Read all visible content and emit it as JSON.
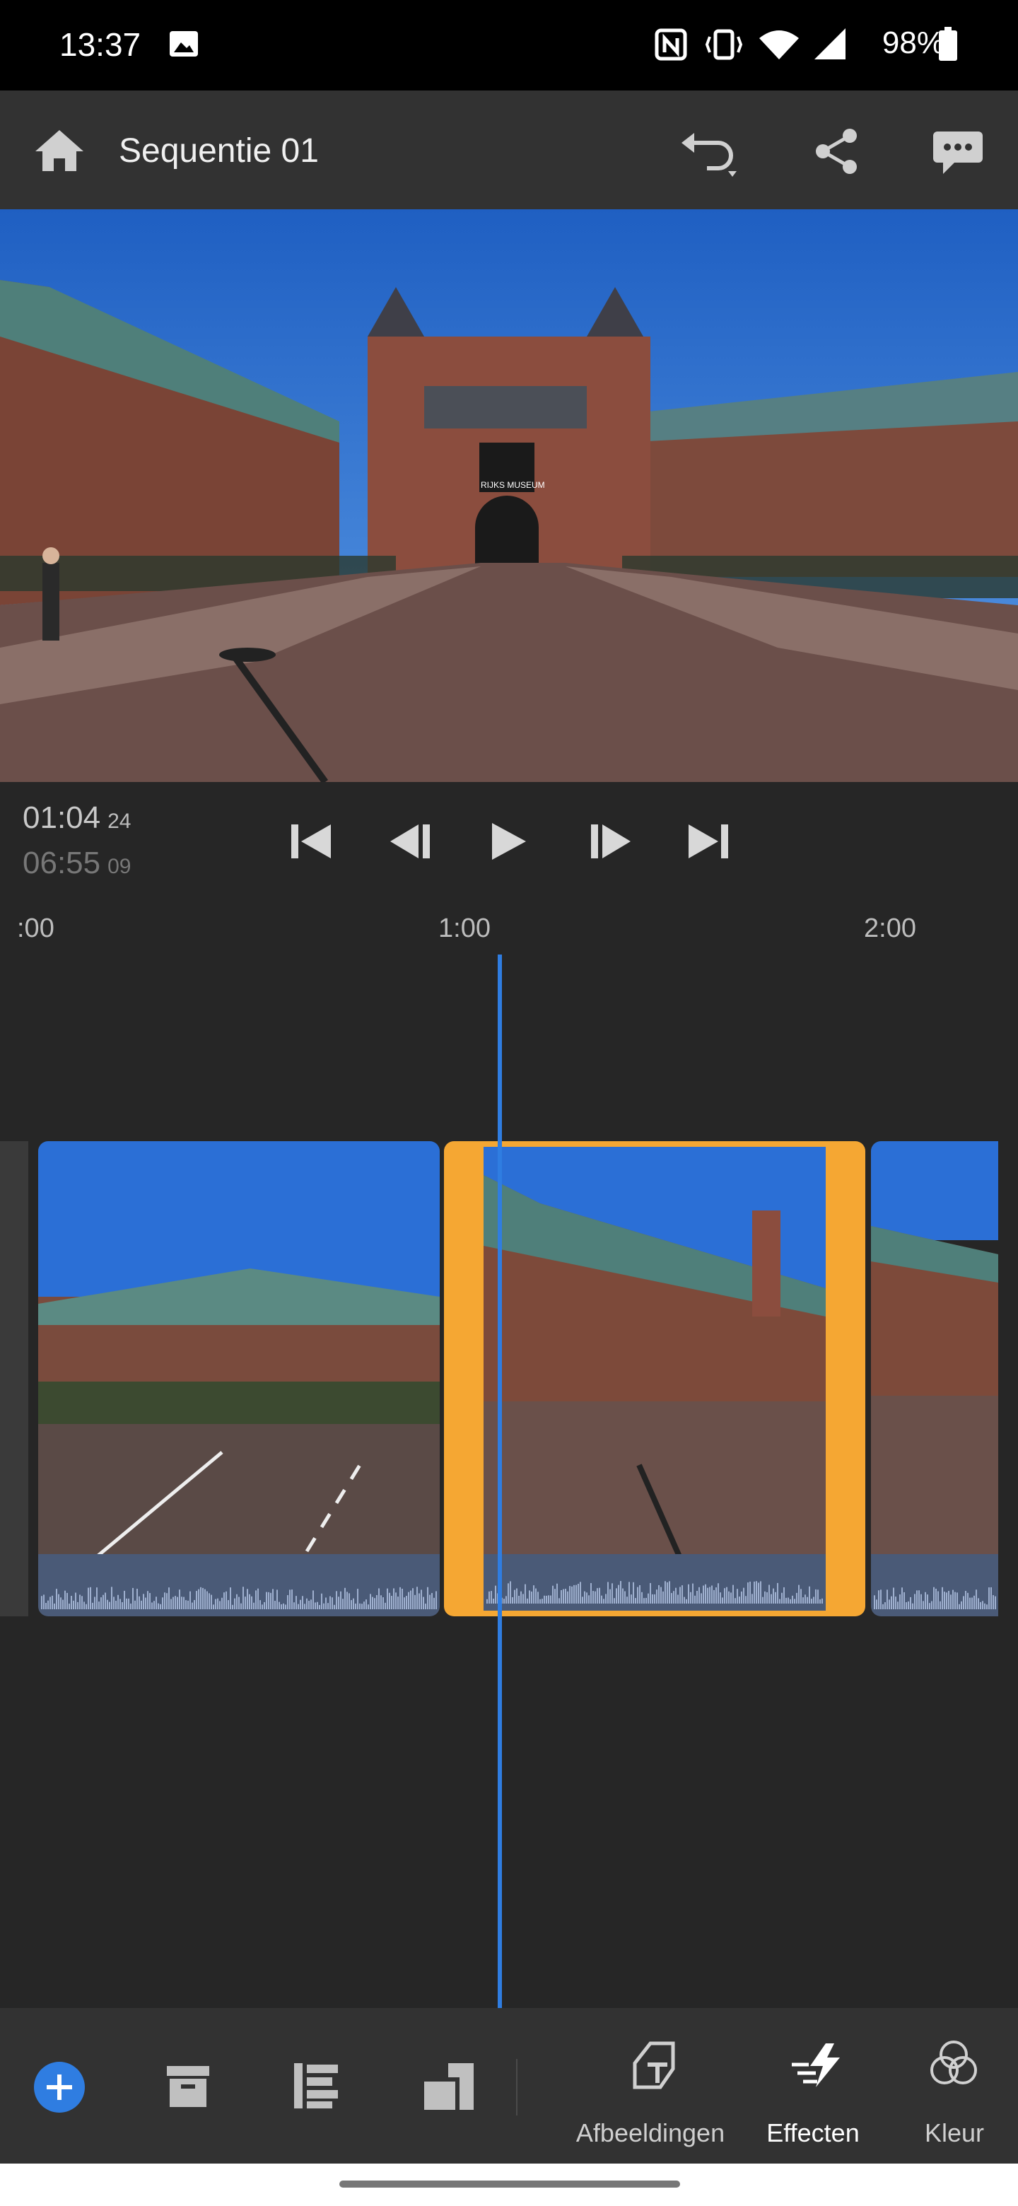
{
  "status_bar": {
    "time": "13:37",
    "battery": "98%",
    "icons": [
      "image-icon",
      "nfc-icon",
      "vibrate-icon",
      "wifi-icon",
      "signal-icon",
      "battery-icon"
    ]
  },
  "app_bar": {
    "title": "Sequentie 01",
    "icons": [
      "home-icon",
      "undo-icon",
      "share-icon",
      "comment-icon"
    ]
  },
  "preview": {
    "sign_text": "RIJKS MUSEUM"
  },
  "playback": {
    "current_time": "01:04",
    "current_frame": "24",
    "total_time": "06:55",
    "total_frame": "09",
    "controls": [
      "skip-to-start-icon",
      "step-back-icon",
      "play-icon",
      "step-forward-icon",
      "skip-to-end-icon"
    ]
  },
  "ruler": {
    "labels": [
      ":00",
      "1:00",
      "2:00"
    ]
  },
  "timeline": {
    "selected_clip_index": 1,
    "accent_color": "#f5a733",
    "playhead_color": "#2f7de1"
  },
  "toolbar": {
    "left_icons": [
      "add-icon",
      "archive-icon",
      "list-icon",
      "aspect-ratio-icon"
    ],
    "items": [
      {
        "label": "Afbeeldingen",
        "icon": "titles-icon"
      },
      {
        "label": "Effecten",
        "icon": "effects-icon"
      },
      {
        "label": "Kleur",
        "icon": "color-icon"
      }
    ]
  }
}
